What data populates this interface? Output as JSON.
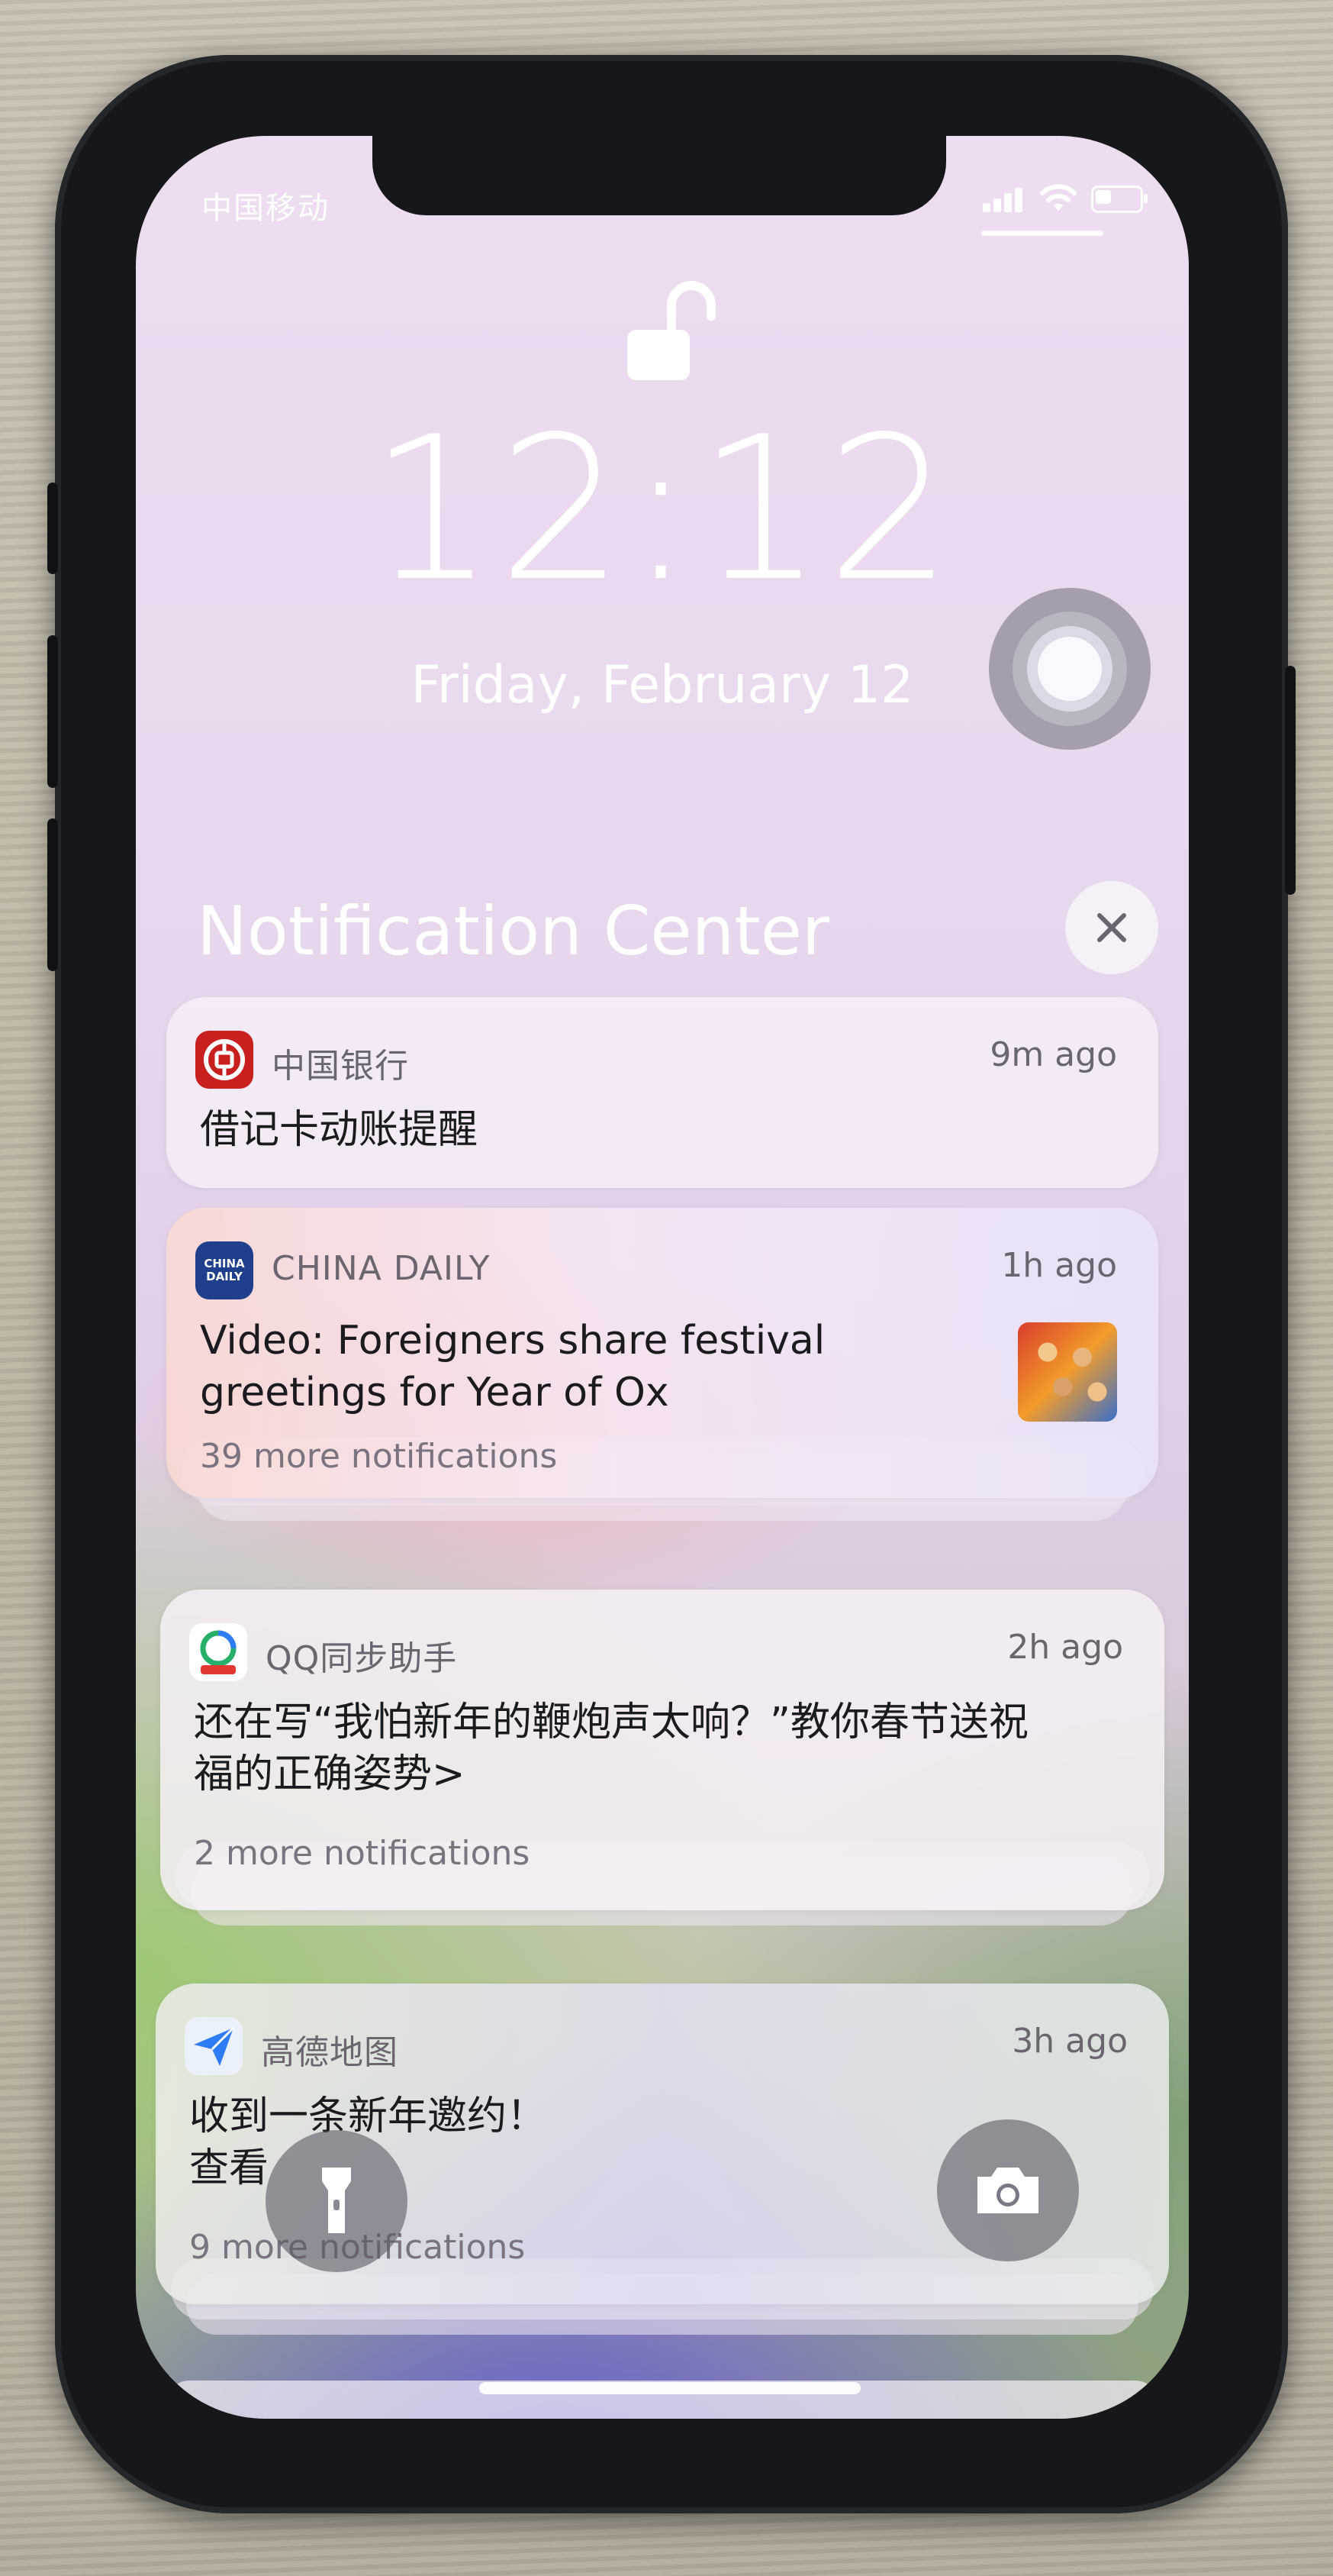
{
  "status_bar": {
    "carrier": "中国移动",
    "icons": [
      "signal-icon",
      "wifi-icon",
      "battery-icon"
    ],
    "battery_level": 0.35
  },
  "lock_screen": {
    "time": "12:12",
    "date": "Friday, February 12",
    "lock_state": "unlocked"
  },
  "notification_center": {
    "title": "Notification Center",
    "close_label": "✕",
    "notifications": [
      {
        "app": "中国银行",
        "icon": "bank-of-china-icon",
        "time_ago": "9m ago",
        "message_lines": [
          "借记卡动账提醒"
        ],
        "more": ""
      },
      {
        "app": "CHINA DAILY",
        "icon": "china-daily-icon",
        "icon_text_1": "CHINA",
        "icon_text_2": "DAILY",
        "time_ago": "1h ago",
        "message_lines": [
          "Video: Foreigners share festival",
          "greetings for Year of Ox"
        ],
        "more": "39 more notifications"
      },
      {
        "app": "QQ同步助手",
        "icon": "qq-sync-icon",
        "time_ago": "2h ago",
        "message_lines": [
          "还在写“我怕新年的鞭炮声太响？”教你春节送祝",
          "福的正确姿势>"
        ],
        "more": "2 more notifications"
      },
      {
        "app": "高德地图",
        "icon": "amap-icon",
        "time_ago": "3h ago",
        "message_lines": [
          "收到一条新年邀约！",
          "查看"
        ],
        "more": "9 more notifications"
      }
    ]
  },
  "quick_actions": {
    "flashlight": "flashlight-icon",
    "camera": "camera-icon"
  },
  "colors": {
    "bank_red": "#c8201f",
    "china_daily_blue": "#1f3f8c",
    "amap_blue": "#2f7df6"
  }
}
